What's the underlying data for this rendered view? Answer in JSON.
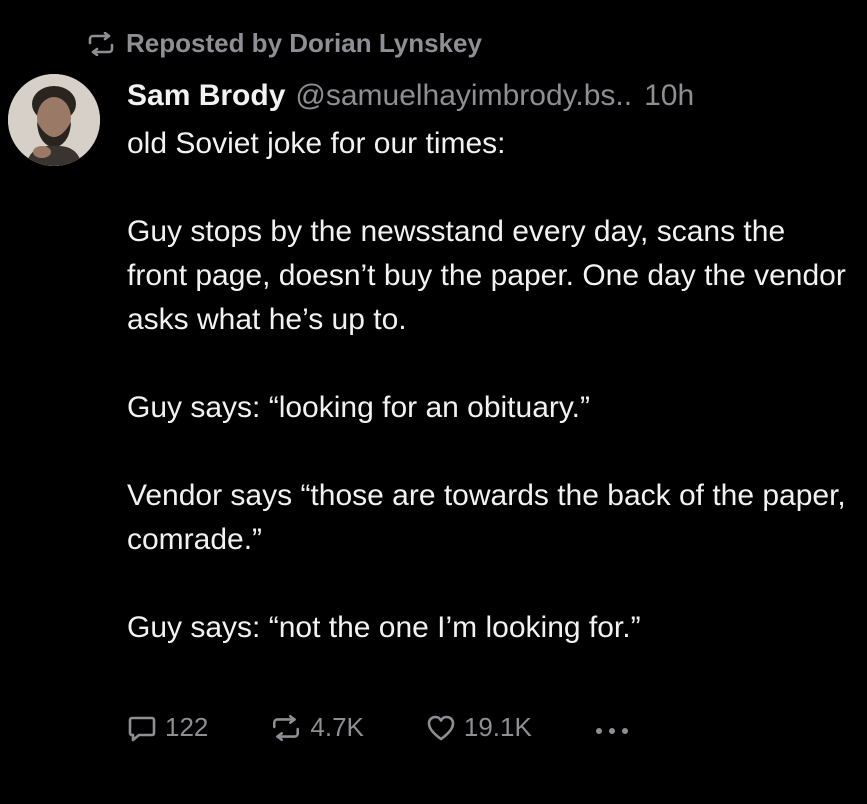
{
  "repost": {
    "icon": "repost-icon",
    "label": "Reposted by Dorian Lynskey"
  },
  "post": {
    "author_name": "Sam Brody",
    "author_handle": "@samuelhayimbrody.bs..",
    "timestamp": "10h",
    "avatar": "avatar-photo",
    "paragraphs": [
      "old Soviet joke for our times:",
      "Guy stops by the newsstand every day, scans the front page, doesn’t buy the paper. One day the vendor asks what he’s up to.",
      "Guy says: “looking for an obituary.”",
      "Vendor says “those are towards the back of the paper, comrade.”",
      "Guy says: “not the one I’m looking for.”"
    ]
  },
  "actions": {
    "reply": {
      "icon": "reply-icon",
      "count": "122"
    },
    "repost": {
      "icon": "repost-icon",
      "count": "4.7K"
    },
    "like": {
      "icon": "heart-icon",
      "count": "19.1K"
    },
    "more": {
      "icon": "more-dots-icon"
    }
  },
  "colors": {
    "background": "#000000",
    "text": "#f2f2f2",
    "muted": "#8e8e93"
  }
}
